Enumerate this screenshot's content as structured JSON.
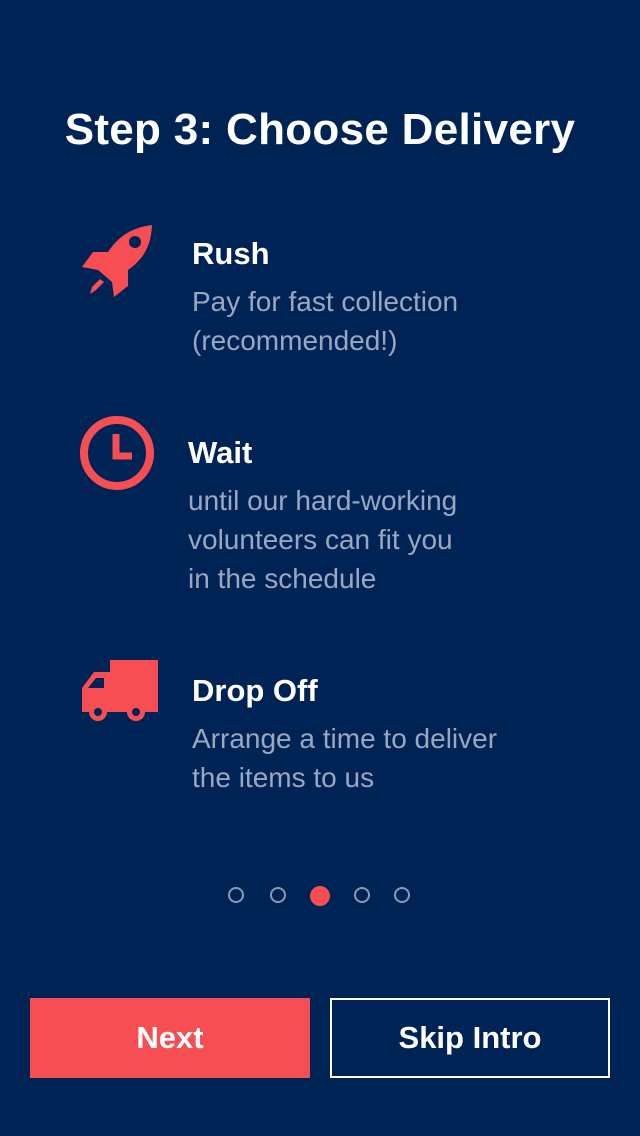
{
  "title": "Step 3: Choose Delivery",
  "accent_color": "#f64e52",
  "background_color": "#002355",
  "items": [
    {
      "icon": "rocket-icon",
      "heading": "Rush",
      "description": "Pay for fast collection\n(recommended!)"
    },
    {
      "icon": "clock-icon",
      "heading": "Wait",
      "description": "until our hard-working\nvolunteers can fit you\nin the schedule"
    },
    {
      "icon": "truck-icon",
      "heading": "Drop Off",
      "description": "Arrange a time to deliver\nthe items to us"
    }
  ],
  "pagination": {
    "total": 5,
    "current": 3
  },
  "buttons": {
    "next_label": "Next",
    "skip_label": "Skip Intro"
  }
}
